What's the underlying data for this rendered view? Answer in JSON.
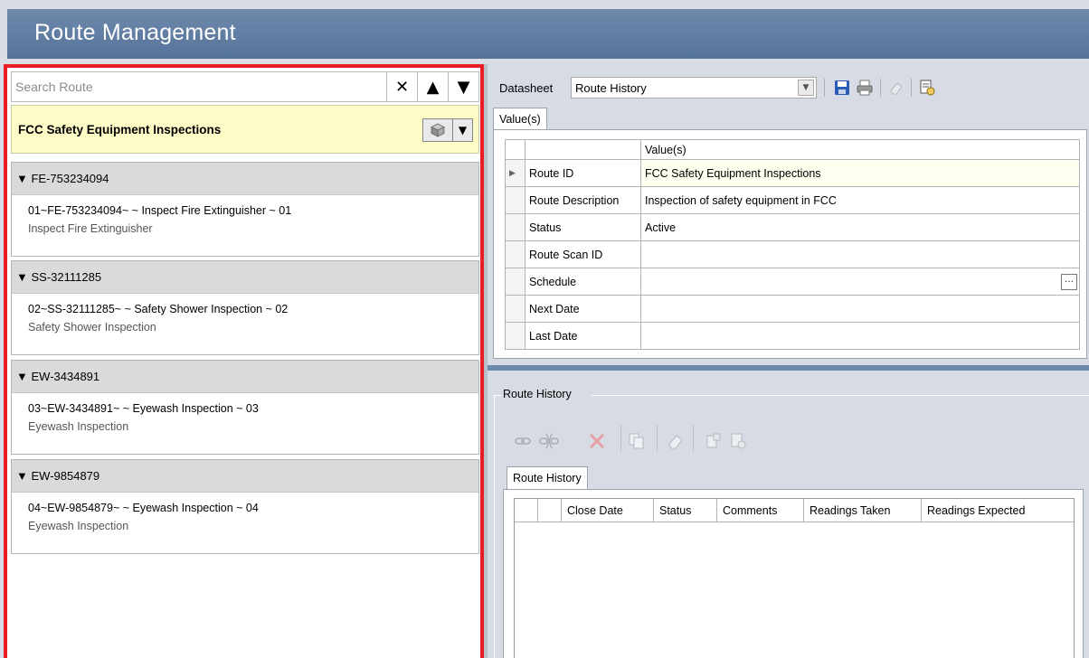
{
  "app": {
    "title": "Route Management"
  },
  "search": {
    "placeholder": "Search Route",
    "clear_symbol": "✕",
    "up_symbol": "▲",
    "down_symbol": "▼"
  },
  "route": {
    "name": "FCC Safety Equipment Inspections",
    "dropdown_symbol": "▼"
  },
  "groups": [
    {
      "id": "FE-753234094",
      "line1": "01~FE-753234094~ ~ Inspect Fire Extinguisher ~ 01",
      "line2": "Inspect Fire Extinguisher"
    },
    {
      "id": "SS-32111285",
      "line1": "02~SS-32111285~ ~ Safety Shower Inspection ~ 02",
      "line2": "Safety Shower Inspection"
    },
    {
      "id": "EW-3434891",
      "line1": "03~EW-3434891~ ~ Eyewash Inspection ~ 03",
      "line2": "Eyewash Inspection"
    },
    {
      "id": "EW-9854879",
      "line1": "04~EW-9854879~ ~ Eyewash Inspection ~ 04",
      "line2": "Eyewash Inspection"
    }
  ],
  "toolbar": {
    "datasheet_label": "Datasheet",
    "datasheet_value": "Route History"
  },
  "tabs": {
    "values_tab": "Value(s)",
    "route_history_tab": "Route History"
  },
  "datasheet": {
    "column_header": "Value(s)",
    "rows": [
      {
        "field": "Route ID",
        "value": "FCC Safety Equipment Inspections"
      },
      {
        "field": "Route Description",
        "value": "Inspection of safety equipment in FCC"
      },
      {
        "field": "Status",
        "value": "Active"
      },
      {
        "field": "Route Scan ID",
        "value": ""
      },
      {
        "field": "Schedule",
        "value": ""
      },
      {
        "field": "Next Date",
        "value": ""
      },
      {
        "field": "Last Date",
        "value": ""
      }
    ]
  },
  "route_history": {
    "section_label": "Route History",
    "columns": [
      "Close Date",
      "Status",
      "Comments",
      "Readings Taken",
      "Readings Expected"
    ]
  },
  "colors": {
    "title_bar": "#5e7ba1",
    "highlight_border": "#ec1c24",
    "route_header_bg": "#fdfcc6"
  }
}
